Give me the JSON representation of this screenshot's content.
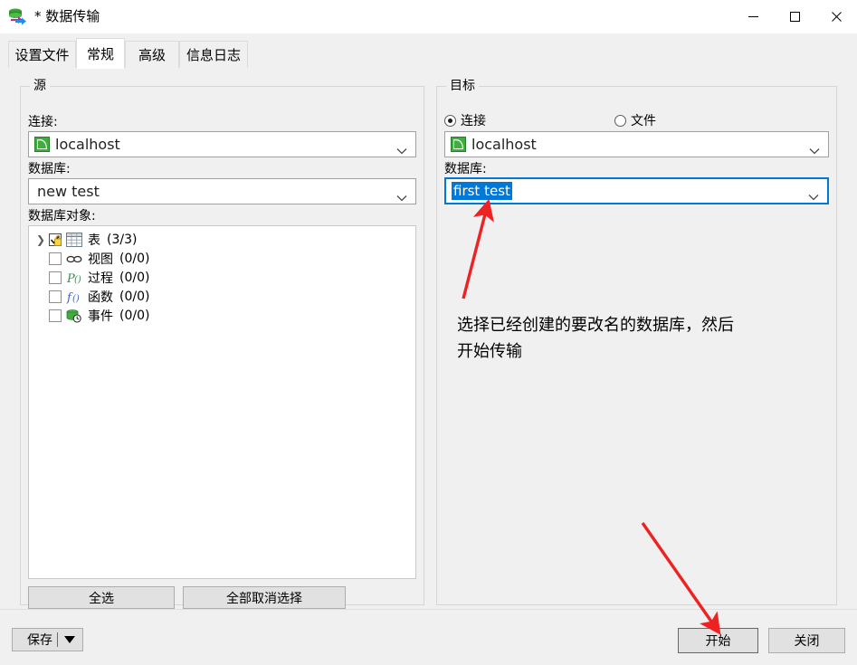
{
  "window": {
    "title": "* 数据传输",
    "app_icon": "data-transfer-icon",
    "minimize": "—",
    "maximize": "☐",
    "close": "✕"
  },
  "tabs": [
    {
      "label": "设置文件",
      "active": false
    },
    {
      "label": "常规",
      "active": true
    },
    {
      "label": "高级",
      "active": false
    },
    {
      "label": "信息日志",
      "active": false
    }
  ],
  "source": {
    "legend": "源",
    "connection_label": "连接:",
    "connection_value": "localhost",
    "database_label": "数据库:",
    "database_value": "new test",
    "objects_label": "数据库对象:",
    "tree": [
      {
        "expander": ">",
        "checkbox": "checked-locked",
        "icon": "table-icon",
        "label": "表",
        "count": "(3/3)"
      },
      {
        "expander": "",
        "checkbox": "unchecked",
        "icon": "view-icon",
        "label": "视图",
        "count": "(0/0)"
      },
      {
        "expander": "",
        "checkbox": "unchecked",
        "icon": "procedure-icon",
        "label": "过程",
        "count": "(0/0)"
      },
      {
        "expander": "",
        "checkbox": "unchecked",
        "icon": "function-icon",
        "label": "函数",
        "count": "(0/0)"
      },
      {
        "expander": "",
        "checkbox": "unchecked",
        "icon": "event-icon",
        "label": "事件",
        "count": "(0/0)"
      }
    ],
    "select_all_label": "全选",
    "deselect_all_label": "全部取消选择"
  },
  "target": {
    "legend": "目标",
    "radio_connection_label": "连接",
    "radio_connection_checked": true,
    "radio_file_label": "文件",
    "radio_file_checked": false,
    "connection_value": "localhost",
    "database_label": "数据库:",
    "database_value": "first test",
    "database_focused": true
  },
  "annotation": {
    "text": "选择已经创建的要改名的数据库，然后\n开始传输",
    "arrow_color": "#ee2222"
  },
  "footer": {
    "save_label": "保存",
    "start_label": "开始",
    "close_label": "关闭"
  },
  "colors": {
    "accent": "#0078d7",
    "window_bg": "#f0f0f0",
    "field_bg": "#ffffff",
    "annotation_red": "#ee2222"
  }
}
